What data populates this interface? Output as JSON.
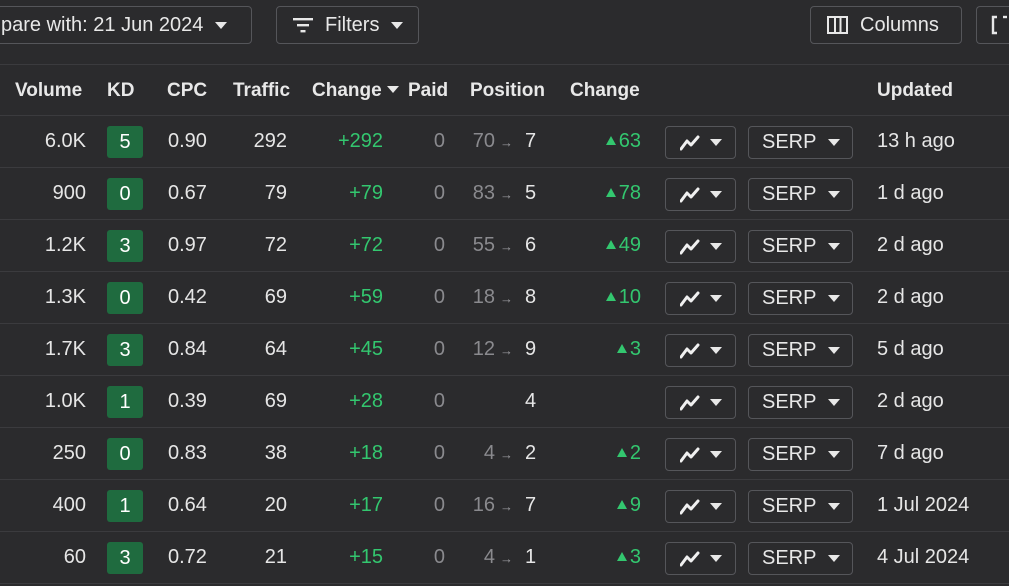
{
  "toolbar": {
    "compare_label": "pare with: 21 Jun 2024",
    "filters_label": "Filters",
    "columns_label": "Columns"
  },
  "headers": {
    "volume": "Volume",
    "kd": "KD",
    "cpc": "CPC",
    "traffic": "Traffic",
    "change": "Change",
    "paid": "Paid",
    "position": "Position",
    "position_change": "Change",
    "updated": "Updated"
  },
  "serp_label": "SERP",
  "rows": [
    {
      "volume": "6.0K",
      "kd": "5",
      "cpc": "0.90",
      "traffic": "292",
      "change": "+292",
      "paid": "0",
      "pos_from": "70",
      "pos_to": "7",
      "pos_change": "63",
      "updated": "13 h ago"
    },
    {
      "volume": "900",
      "kd": "0",
      "cpc": "0.67",
      "traffic": "79",
      "change": "+79",
      "paid": "0",
      "pos_from": "83",
      "pos_to": "5",
      "pos_change": "78",
      "updated": "1 d ago"
    },
    {
      "volume": "1.2K",
      "kd": "3",
      "cpc": "0.97",
      "traffic": "72",
      "change": "+72",
      "paid": "0",
      "pos_from": "55",
      "pos_to": "6",
      "pos_change": "49",
      "updated": "2 d ago"
    },
    {
      "volume": "1.3K",
      "kd": "0",
      "cpc": "0.42",
      "traffic": "69",
      "change": "+59",
      "paid": "0",
      "pos_from": "18",
      "pos_to": "8",
      "pos_change": "10",
      "updated": "2 d ago"
    },
    {
      "volume": "1.7K",
      "kd": "3",
      "cpc": "0.84",
      "traffic": "64",
      "change": "+45",
      "paid": "0",
      "pos_from": "12",
      "pos_to": "9",
      "pos_change": "3",
      "updated": "5 d ago"
    },
    {
      "volume": "1.0K",
      "kd": "1",
      "cpc": "0.39",
      "traffic": "69",
      "change": "+28",
      "paid": "0",
      "pos_from": "",
      "pos_to": "4",
      "pos_change": "",
      "updated": "2 d ago"
    },
    {
      "volume": "250",
      "kd": "0",
      "cpc": "0.83",
      "traffic": "38",
      "change": "+18",
      "paid": "0",
      "pos_from": "4",
      "pos_to": "2",
      "pos_change": "2",
      "updated": "7 d ago"
    },
    {
      "volume": "400",
      "kd": "1",
      "cpc": "0.64",
      "traffic": "20",
      "change": "+17",
      "paid": "0",
      "pos_from": "16",
      "pos_to": "7",
      "pos_change": "9",
      "updated": "1 Jul 2024"
    },
    {
      "volume": "60",
      "kd": "3",
      "cpc": "0.72",
      "traffic": "21",
      "change": "+15",
      "paid": "0",
      "pos_from": "4",
      "pos_to": "1",
      "pos_change": "3",
      "updated": "4 Jul 2024"
    }
  ]
}
